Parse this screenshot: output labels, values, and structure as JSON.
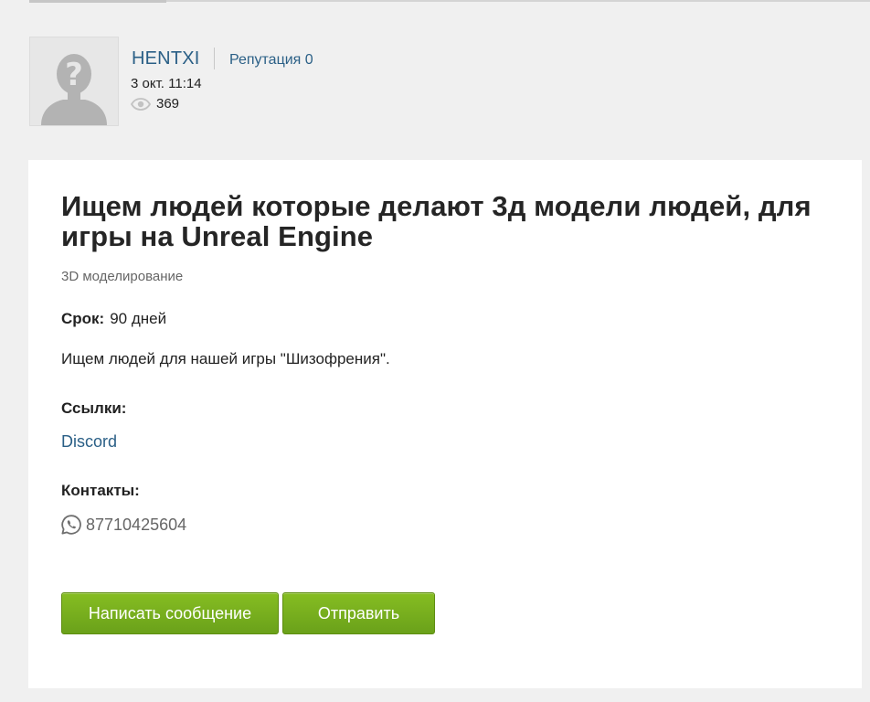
{
  "author": {
    "name": "HENTXI",
    "reputation": "Репутация 0",
    "date": "3 окт. 11:14",
    "views": "369"
  },
  "post": {
    "title": "Ищем людей которые делают 3д модели людей, для игры на Unreal Engine",
    "category": "3D моделирование",
    "term_label": "Срок:",
    "term_value": "90 дней",
    "description": "Ищем людей для нашей игры \"Шизофрения\".",
    "links_heading": "Ссылки:",
    "links": [
      "Discord"
    ],
    "contacts_heading": "Контакты:",
    "phone": "87710425604"
  },
  "actions": {
    "message_label": "Написать сообщение",
    "send_label": "Отправить"
  },
  "colors": {
    "link": "#2a5f86",
    "button": "#77b01e",
    "background": "#f0f0f0"
  },
  "icons": {
    "avatar": "default-avatar-icon",
    "views": "eye-icon",
    "phone": "whatsapp-icon"
  }
}
